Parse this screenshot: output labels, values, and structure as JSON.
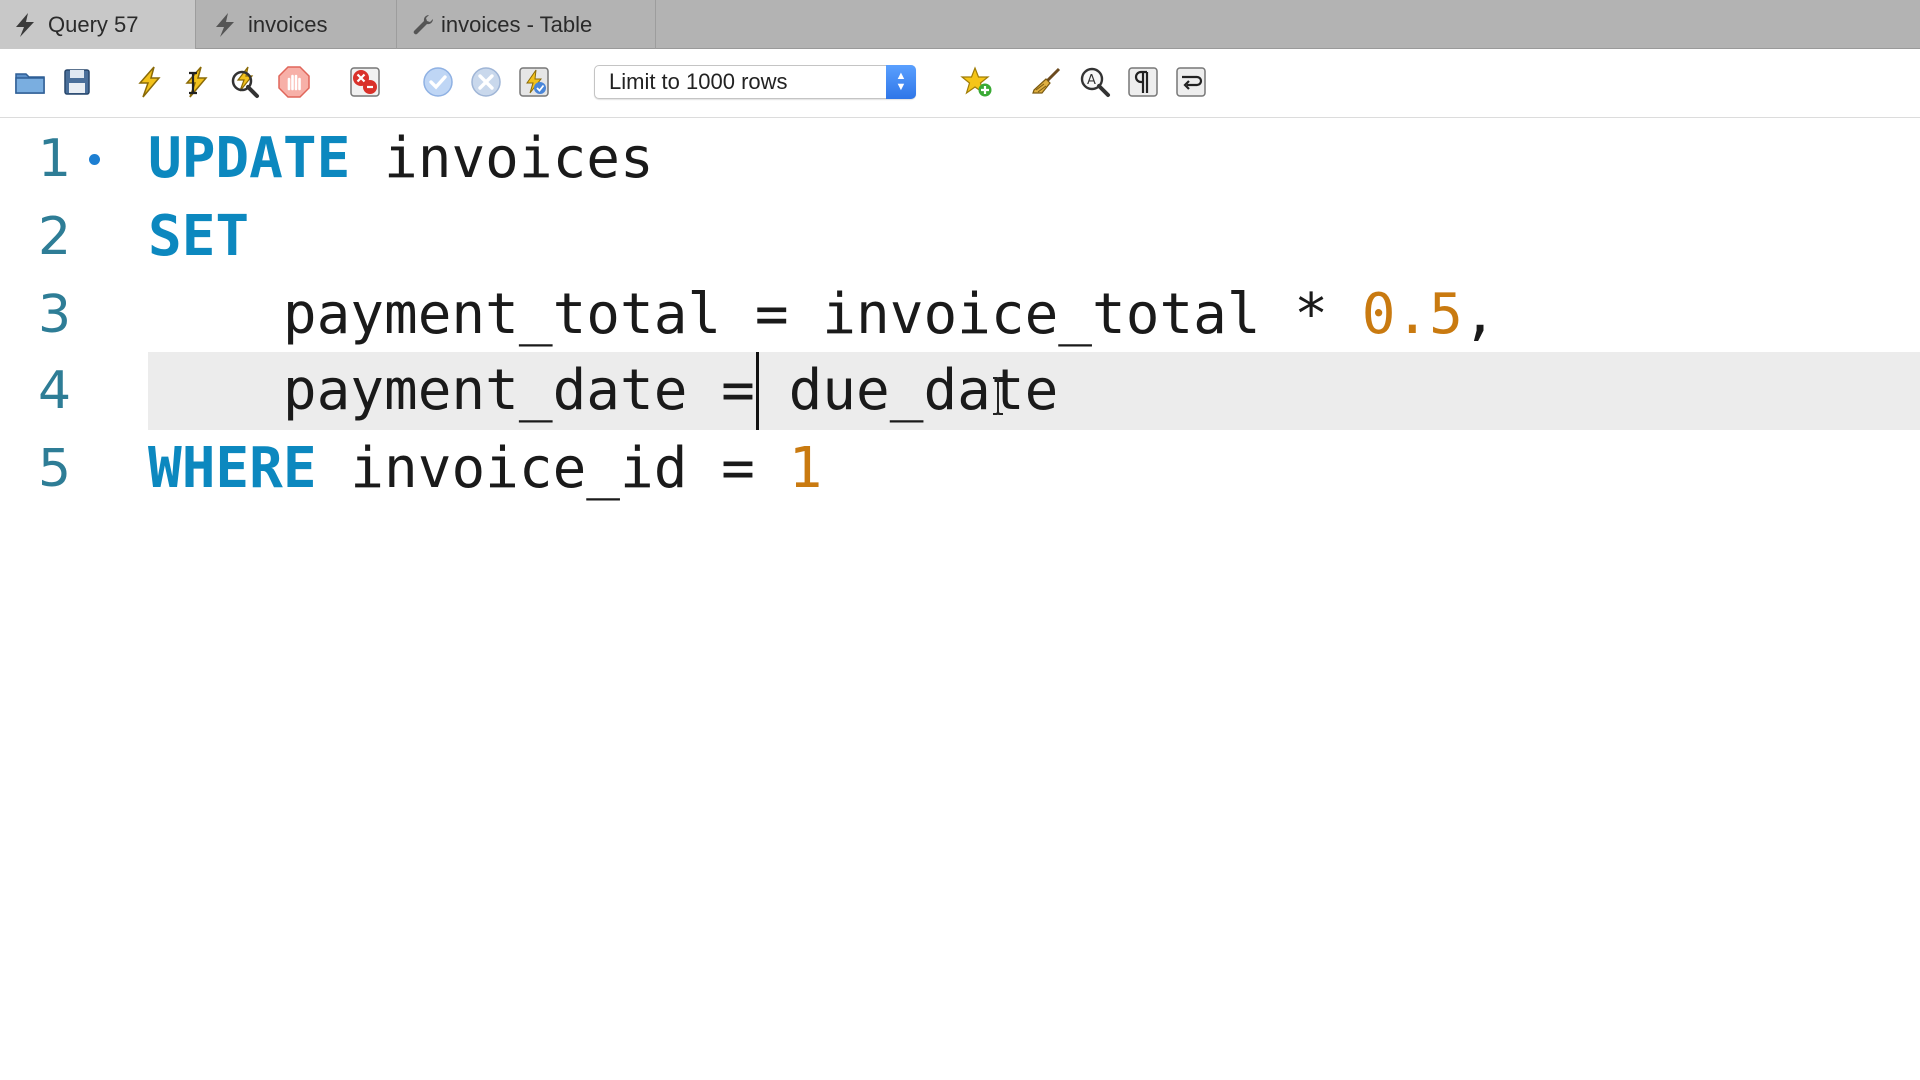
{
  "tabs": [
    {
      "label": "Query 57",
      "icon": "lightning-icon",
      "active": true
    },
    {
      "label": "invoices",
      "icon": "lightning-icon",
      "active": false
    },
    {
      "label": "invoices - Table",
      "icon": "wrench-icon",
      "active": false
    }
  ],
  "toolbar": {
    "limit_select": {
      "value": "Limit to 1000 rows"
    },
    "icons": [
      "open-folder-icon",
      "save-icon",
      "execute-icon",
      "execute-current-icon",
      "explain-icon",
      "stop-icon",
      "toggle-error-icon",
      "commit-icon",
      "rollback-icon",
      "autocommit-icon",
      "add-snippet-icon",
      "beautify-icon",
      "find-icon",
      "invisible-chars-icon",
      "wrap-lines-icon"
    ]
  },
  "editor": {
    "current_line": 4,
    "lines": [
      {
        "number": "1",
        "tokens": [
          {
            "t": "UPDATE",
            "c": "kw"
          },
          {
            "t": " invoices",
            "c": ""
          }
        ]
      },
      {
        "number": "2",
        "tokens": [
          {
            "t": "SET",
            "c": "kw"
          }
        ]
      },
      {
        "number": "3",
        "tokens": [
          {
            "t": "    payment_total = invoice_total * ",
            "c": ""
          },
          {
            "t": "0.5",
            "c": "num"
          },
          {
            "t": ",",
            "c": ""
          }
        ]
      },
      {
        "number": "4",
        "tokens": [
          {
            "t": "    payment_date = due_date",
            "c": ""
          }
        ]
      },
      {
        "number": "5",
        "tokens": [
          {
            "t": "WHERE",
            "c": "kw"
          },
          {
            "t": " invoice_id = ",
            "c": ""
          },
          {
            "t": "1",
            "c": "num"
          }
        ]
      }
    ]
  },
  "colors": {
    "keyword": "#0c88bf",
    "number": "#c97a10",
    "line_number": "#2e7d96",
    "current_line_bg": "#ececec"
  }
}
